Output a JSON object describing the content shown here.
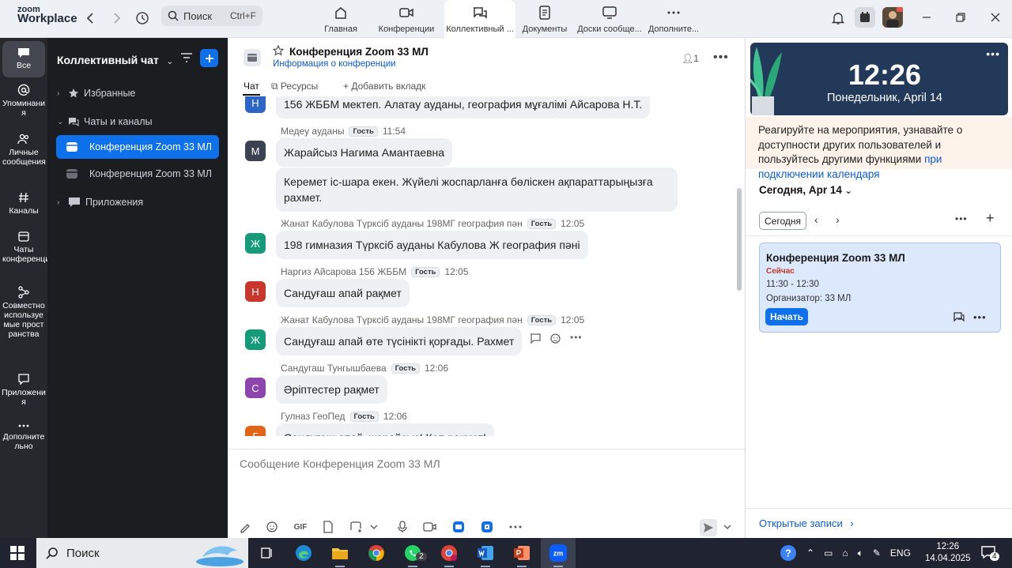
{
  "app": {
    "logo_line1": "zoom",
    "logo_line2": "Workplace"
  },
  "search": {
    "label": "Поиск",
    "shortcut": "Ctrl+F"
  },
  "nav_tabs": [
    {
      "label": "Главная",
      "icon": "home-icon"
    },
    {
      "label": "Конференции",
      "icon": "video-icon"
    },
    {
      "label": "Коллективный ...",
      "icon": "chat-icon",
      "active": true
    },
    {
      "label": "Документы",
      "icon": "document-icon"
    },
    {
      "label": "Доски сообще...",
      "icon": "whiteboard-icon"
    },
    {
      "label": "Дополните...",
      "icon": "more-icon"
    }
  ],
  "rail": [
    {
      "label": "Все",
      "icon": "chat-bubble-icon",
      "active": true
    },
    {
      "label": "Упоминания",
      "icon": "at-icon"
    },
    {
      "label": "Личные сообщения",
      "icon": "people-icon"
    },
    {
      "label": "Каналы",
      "icon": "hash-icon"
    },
    {
      "label": "Чаты конференции",
      "icon": "calendar-chat-icon"
    },
    {
      "label": "Совместно используемые пространства",
      "icon": "share-icon"
    },
    {
      "label": "Приложения",
      "icon": "apps-icon"
    },
    {
      "label": "Дополнительно",
      "icon": "more-icon"
    }
  ],
  "sidebar": {
    "title": "Коллективный чат",
    "rows": [
      {
        "label": "Избранные"
      },
      {
        "label": "Чаты и каналы"
      },
      {
        "label": "Конференция Zoom 33 МЛ"
      },
      {
        "label": "Конференция Zoom 33 МЛ"
      },
      {
        "label": "Приложения"
      }
    ]
  },
  "chat": {
    "title": "Конференция Zoom 33 МЛ",
    "subtitle": "Информация о конференции",
    "members": "1",
    "tabs": [
      "Чат",
      "Ресурсы",
      "Добавить вкладк"
    ],
    "guest_badge": "Гость",
    "messages": [
      {
        "avatar": "Н",
        "color": "#2d64c8",
        "sender": "",
        "time": "",
        "guest": false,
        "text": "156 ЖББМ  мектеп. Алатау ауданы, география мұғалімі Айсарова Н.Т."
      },
      {
        "avatar": "М",
        "color": "#3b4252",
        "sender": "Медеу ауданы",
        "time": "11:54",
        "guest": true,
        "text": "Жарайсыз Нагима Амантаевна"
      },
      {
        "avatar": "",
        "color": "",
        "sender": "",
        "time": "",
        "guest": false,
        "text": "Керемет іс-шара екен. Жүйелі жоспарланға бөліскен ақпараттарыңызға рахмет."
      },
      {
        "avatar": "Ж",
        "color": "#169b7a",
        "sender": "Жанат  Кабулова Түрксіб ауданы 198МГ география пән",
        "time": "12:05",
        "guest": true,
        "text": "198 гимназия Түрксіб ауданы Кабулова Ж география пәні"
      },
      {
        "avatar": "Н",
        "color": "#c9372c",
        "sender": "Наргиз Айсарова 156 ЖББМ",
        "time": "12:05",
        "guest": true,
        "text": "Сандуғаш апай рақмет"
      },
      {
        "avatar": "Ж",
        "color": "#169b7a",
        "sender": "Жанат  Кабулова Түрксіб ауданы 198МГ география пән",
        "time": "12:05",
        "guest": true,
        "text": "Сандуғаш апай өте түсінікті қорғады. Рахмет"
      },
      {
        "avatar": "С",
        "color": "#8e44ad",
        "sender": "Сандугаш Тунгышбаева",
        "time": "12:06",
        "guest": true,
        "text": "Әріптестер рақмет"
      },
      {
        "avatar": "Г",
        "color": "#e36414",
        "sender": "Гулназ ГеоПед",
        "time": "12:06",
        "guest": true,
        "text": "Сандуғаш апай, жарайсыз! Көп рақмет!"
      }
    ],
    "composer_placeholder": "Сообщение Конференция Zoom 33 МЛ",
    "composer_tools": [
      "format-icon",
      "emoji-icon",
      "GIF",
      "file-icon",
      "screenshot-icon",
      "chevron-down-icon",
      "audio-icon",
      "video-clip-icon",
      "whiteboard-icon",
      "app-icon",
      "more-icon"
    ]
  },
  "right_panel": {
    "time": "12:26",
    "date": "Понедельник, April 14",
    "promo_text": "Реагируйте на мероприятия, узнавайте о доступности других пользователей и пользуйтесь другими функциями ",
    "promo_link": "при подключении календаря",
    "today_label": "Сегодня, Apr 14",
    "today_button": "Сегодня",
    "event": {
      "title": "Конференция Zoom 33 МЛ",
      "status": "Сейчас",
      "time": "11:30 - 12:30",
      "organizer": "Организатор: 33 МЛ",
      "start": "Начать"
    },
    "open_records": "Открытые записи"
  },
  "taskbar": {
    "search": "Поиск",
    "lang": "ENG",
    "time": "12:26",
    "date": "14.04.2025",
    "whatsapp_badge": "2",
    "notifications": "4"
  }
}
